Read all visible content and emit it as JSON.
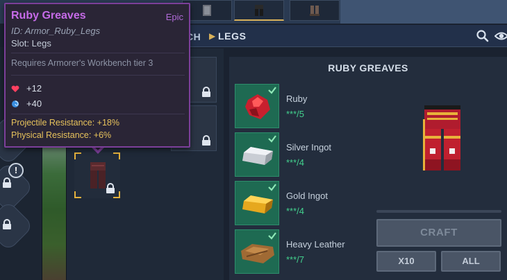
{
  "breadcrumb": {
    "previous": "CH",
    "separator": "▶",
    "current": "LEGS"
  },
  "toolbar": {
    "search_icon": "search-icon",
    "visibility_icon": "eye-icon"
  },
  "tooltip": {
    "name": "Ruby Greaves",
    "rarity": "Epic",
    "id_line": "ID: Armor_Ruby_Legs",
    "slot_line": "Slot: Legs",
    "requirement": "Requires Armorer's Workbench tier 3",
    "stats": [
      {
        "icon": "heart-icon",
        "value": "+12"
      },
      {
        "icon": "mana-swirl-icon",
        "value": "+40"
      }
    ],
    "resistances": [
      "Projectile Resistance: +18%",
      "Physical Resistance: +6%"
    ]
  },
  "rail": {
    "alert_label": "!"
  },
  "detail": {
    "title": "RUBY GREAVES",
    "ingredients": [
      {
        "name": "Ruby",
        "qty": "***/5",
        "icon": "ruby-icon"
      },
      {
        "name": "Silver Ingot",
        "qty": "***/4",
        "icon": "silver-ingot-icon"
      },
      {
        "name": "Gold Ingot",
        "qty": "***/4",
        "icon": "gold-ingot-icon"
      },
      {
        "name": "Heavy Leather",
        "qty": "***/7",
        "icon": "heavy-leather-icon"
      }
    ],
    "craft_label": "CRAFT",
    "x10_label": "X10",
    "all_label": "ALL"
  },
  "colors": {
    "rarity_epic": "#c66be8",
    "ingredient_ok_bg": "#1e6a52",
    "qty_green": "#43d18e",
    "selection_gold": "#e4b13d"
  }
}
